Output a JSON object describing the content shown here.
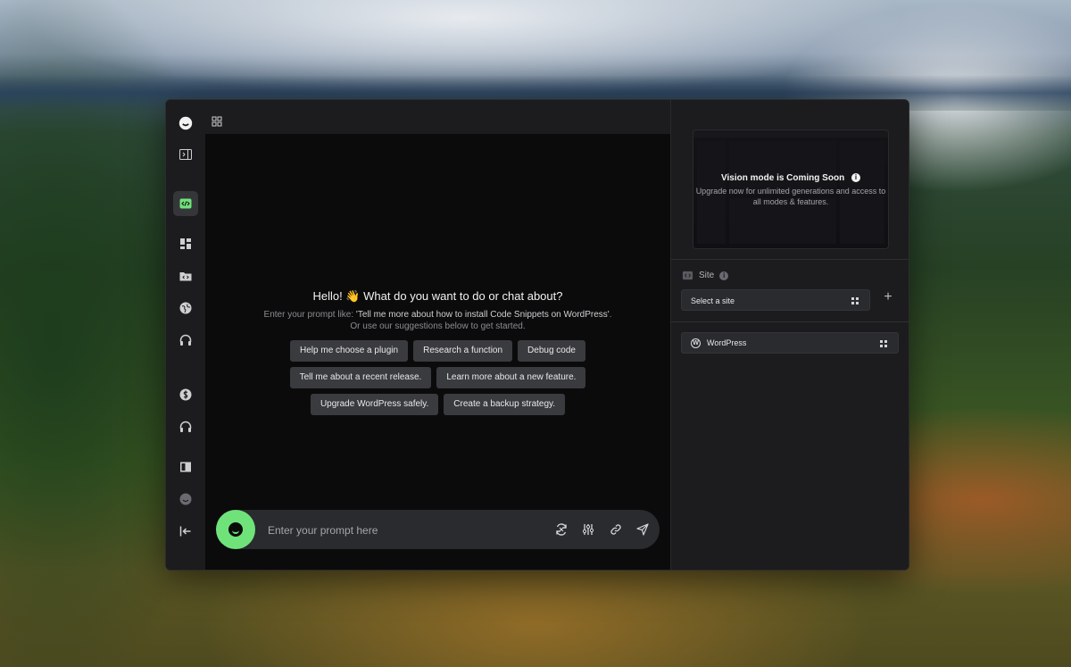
{
  "chat": {
    "greeting": "Hello! 👋 What do you want to do or chat about?",
    "hint_prefix": "Enter your prompt like: ",
    "hint_example": "'Tell me more about how to install Code Snippets on WordPress'",
    "hint_suffix": ". Or use our suggestions below to get started.",
    "suggestions_row1": [
      "Help me choose a plugin",
      "Research a function",
      "Debug code"
    ],
    "suggestions_row2": [
      "Tell me about a recent release.",
      "Learn more about a new feature."
    ],
    "suggestions_row3": [
      "Upgrade WordPress safely.",
      "Create a backup strategy."
    ],
    "prompt_placeholder": "Enter your prompt here"
  },
  "side_panel": {
    "vision_title": "Vision mode is Coming Soon",
    "vision_desc": "Upgrade now for unlimited generations and access to all modes & features.",
    "site_label": "Site",
    "select_site": "Select a site",
    "platform_item": "WordPress"
  },
  "colors": {
    "accent": "#6fe37a",
    "panel_bg": "#1c1c1e",
    "chat_bg": "#0b0b0c",
    "chip_bg": "#3a3b3f"
  }
}
